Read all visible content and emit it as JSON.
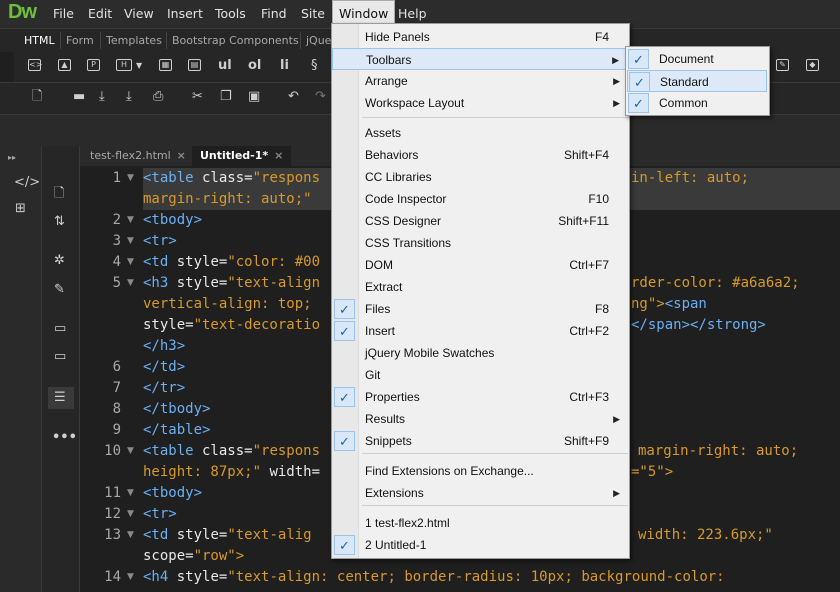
{
  "app": {
    "logo": "Dw"
  },
  "menubar": [
    "File",
    "Edit",
    "View",
    "Insert",
    "Tools",
    "Find",
    "Site",
    "Window",
    "Help"
  ],
  "insert_tabs": [
    "HTML",
    "Form",
    "Templates",
    "Bootstrap Components",
    "jQue"
  ],
  "insert_icons": [
    "ul",
    "ol",
    "li"
  ],
  "doc_tabs": [
    {
      "name": "test-flex2.html",
      "close": "×"
    },
    {
      "name": "Untitled-1*",
      "close": "×"
    }
  ],
  "line_numbers": [
    "1",
    "2",
    "3",
    "4",
    "5",
    "6",
    "7",
    "8",
    "9",
    "10",
    "11",
    "12",
    "13",
    "14"
  ],
  "code": {
    "l1a": "<table",
    "l1b": " class=",
    "l1c": "\"respons",
    "l1d": "in-left: auto;",
    "l1e": "margin-right: auto;\"",
    "l2": "<tbody>",
    "l3": "<tr>",
    "l4a": "<td",
    "l4b": " style=",
    "l4c": "\"color: #00",
    "l5a": "<h3",
    "l5b": " style=",
    "l5c": "\"text-align",
    "l5d": "rder-color: #a6a6a2;",
    "l5e": "vertical-align: top;",
    "l5f": "ng\">",
    "l5g": "<span",
    "l5h": "style=",
    "l5i": "\"text-decoratio",
    "l5j": "</span></strong>",
    "l5k": "</h3>",
    "l6": "</td>",
    "l7": "</tr>",
    "l8": "</tbody>",
    "l9": "</table>",
    "l10a": "<table",
    "l10b": " class=",
    "l10c": "\"respons",
    "l10d": "margin-right: auto;",
    "l10e": "height: 87px;\"",
    "l10f": " width=",
    "l10g": "=\"5\">",
    "l11": "<tbody>",
    "l12": "<tr>",
    "l13a": "<td",
    "l13b": " style=",
    "l13c": "\"text-alig",
    "l13d": "width: 223.6px;\"",
    "l13e": "scope=",
    "l13f": "\"row\">",
    "l14a": "<h4",
    "l14b": " style=",
    "l14c": "\"text-align: center; border-radius: 10px; background-color:"
  },
  "window_menu": {
    "items": [
      {
        "label": "Hide Panels",
        "shortcut": "F4",
        "checked": false,
        "arrow": false
      },
      {
        "label": "Toolbars",
        "shortcut": "",
        "checked": false,
        "arrow": true
      },
      {
        "label": "Arrange",
        "shortcut": "",
        "checked": false,
        "arrow": true
      },
      {
        "label": "Workspace Layout",
        "shortcut": "",
        "checked": false,
        "arrow": true
      },
      {
        "label": "Assets",
        "shortcut": "",
        "checked": false,
        "arrow": false
      },
      {
        "label": "Behaviors",
        "shortcut": "Shift+F4",
        "checked": false,
        "arrow": false
      },
      {
        "label": "CC Libraries",
        "shortcut": "",
        "checked": false,
        "arrow": false
      },
      {
        "label": "Code Inspector",
        "shortcut": "F10",
        "checked": false,
        "arrow": false
      },
      {
        "label": "CSS Designer",
        "shortcut": "Shift+F11",
        "checked": false,
        "arrow": false
      },
      {
        "label": "CSS Transitions",
        "shortcut": "",
        "checked": false,
        "arrow": false
      },
      {
        "label": "DOM",
        "shortcut": "Ctrl+F7",
        "checked": false,
        "arrow": false
      },
      {
        "label": "Extract",
        "shortcut": "",
        "checked": false,
        "arrow": false
      },
      {
        "label": "Files",
        "shortcut": "F8",
        "checked": true,
        "arrow": false
      },
      {
        "label": "Insert",
        "shortcut": "Ctrl+F2",
        "checked": true,
        "arrow": false
      },
      {
        "label": "jQuery Mobile Swatches",
        "shortcut": "",
        "checked": false,
        "arrow": false
      },
      {
        "label": "Git",
        "shortcut": "",
        "checked": false,
        "arrow": false
      },
      {
        "label": "Properties",
        "shortcut": "Ctrl+F3",
        "checked": true,
        "arrow": false
      },
      {
        "label": "Results",
        "shortcut": "",
        "checked": false,
        "arrow": true
      },
      {
        "label": "Snippets",
        "shortcut": "Shift+F9",
        "checked": true,
        "arrow": false
      },
      {
        "label": "Find Extensions on Exchange...",
        "shortcut": "",
        "checked": false,
        "arrow": false
      },
      {
        "label": "Extensions",
        "shortcut": "",
        "checked": false,
        "arrow": true
      },
      {
        "label": "1 test-flex2.html",
        "shortcut": "",
        "checked": false,
        "arrow": false
      },
      {
        "label": "2 Untitled-1",
        "shortcut": "",
        "checked": true,
        "arrow": false
      }
    ]
  },
  "toolbars_submenu": [
    {
      "label": "Document",
      "checked": true
    },
    {
      "label": "Standard",
      "checked": true
    },
    {
      "label": "Common",
      "checked": true
    }
  ],
  "glyphs": {
    "check": "✓",
    "arrow": "▶",
    "fold": "▼"
  },
  "colors": {
    "accent": "#6fbf3c",
    "tag": "#6ab0f3",
    "value": "#d79a2b",
    "check": "#1a5fb4"
  }
}
